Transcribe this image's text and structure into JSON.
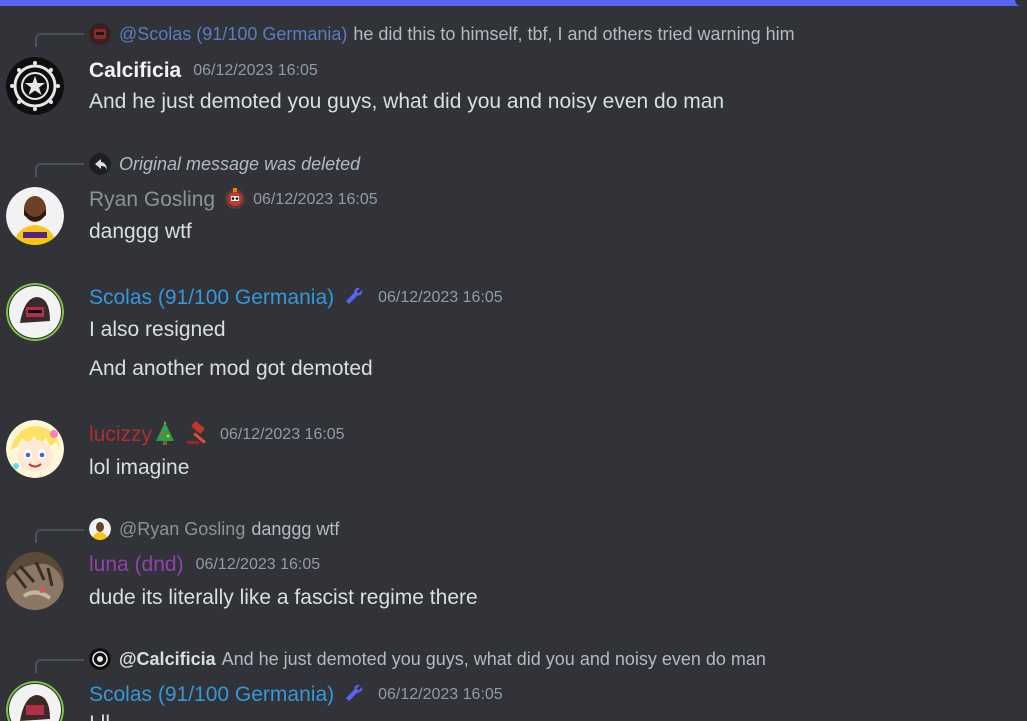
{
  "messages": [
    {
      "reply": {
        "mention": "@Scolas (91/100 Germania)",
        "text": "he did this to himself, tbf, I and others tried warning him"
      },
      "author": "Calcificia",
      "author_color": "#f2f3f5",
      "timestamp": "06/12/2023 16:05",
      "lines": [
        "And he just demoted you guys, what did you and noisy even do man"
      ]
    },
    {
      "reply": {
        "text": "Original message was deleted"
      },
      "author": "Ryan Gosling",
      "author_color": "#8e9297",
      "timestamp": "06/12/2023 16:05",
      "lines": [
        "danggg wtf"
      ]
    },
    {
      "author": "Scolas (91/100 Germania)",
      "author_color": "#3498db",
      "timestamp": "06/12/2023 16:05",
      "lines": [
        "I also resigned",
        "And another mod got demoted"
      ]
    },
    {
      "author": "lucizzy",
      "author_color": "#b22f2f",
      "timestamp": "06/12/2023 16:05",
      "lines": [
        "lol imagine"
      ]
    },
    {
      "reply": {
        "mention": "@Ryan Gosling",
        "text": "danggg wtf"
      },
      "author": "luna (dnd)",
      "author_color": "#8e44ad",
      "timestamp": "06/12/2023 16:05",
      "lines": [
        "dude its literally like a fascist regime there"
      ]
    },
    {
      "reply": {
        "mention": "@Calcificia",
        "text": "And he just demoted you guys, what did you and noisy even do man"
      },
      "author": "Scolas (91/100 Germania)",
      "author_color": "#3498db",
      "timestamp": "06/12/2023 16:05",
      "lines": [
        "I ll"
      ]
    }
  ],
  "icons": {
    "mod_badge": "wrench-icon",
    "gavel_badge": "gavel-icon",
    "tree_emoji": "christmas-tree-icon",
    "reply_deleted": "reply-arrow-icon"
  },
  "colors": {
    "background": "#313338",
    "accent": "#5865f2",
    "mention_color": "#7289da"
  }
}
